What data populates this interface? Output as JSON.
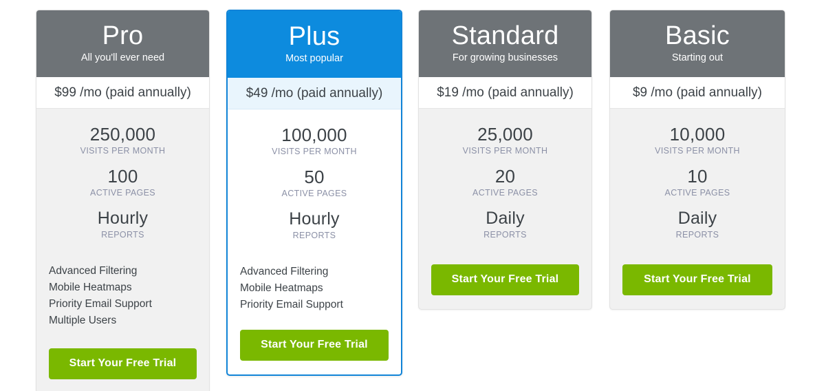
{
  "theme": {
    "header_gray": "#6e7377",
    "header_blue": "#0d8bde",
    "cta_green": "#7ab800",
    "stat_label_color": "#8b90a6",
    "body_gray": "#f1f1f1",
    "featured_price_bg": "#e9f5fd",
    "featured_border": "#1184d8"
  },
  "plans": [
    {
      "id": "pro",
      "name": "Pro",
      "tagline": "All you'll ever need",
      "price": "$99",
      "price_suffix": " /mo (paid annually)",
      "featured": false,
      "stats": [
        {
          "value": "250,000",
          "label": "VISITS PER MONTH"
        },
        {
          "value": "100",
          "label": "ACTIVE PAGES"
        },
        {
          "value": "Hourly",
          "label": "REPORTS"
        }
      ],
      "features": [
        "Advanced Filtering",
        "Mobile Heatmaps",
        "Priority Email Support",
        "Multiple Users"
      ],
      "cta_label": "Start Your Free Trial"
    },
    {
      "id": "plus",
      "name": "Plus",
      "tagline": "Most popular",
      "price": "$49",
      "price_suffix": " /mo (paid annually)",
      "featured": true,
      "stats": [
        {
          "value": "100,000",
          "label": "VISITS PER MONTH"
        },
        {
          "value": "50",
          "label": "ACTIVE PAGES"
        },
        {
          "value": "Hourly",
          "label": "REPORTS"
        }
      ],
      "features": [
        "Advanced Filtering",
        "Mobile Heatmaps",
        "Priority Email Support"
      ],
      "cta_label": "Start Your Free Trial"
    },
    {
      "id": "standard",
      "name": "Standard",
      "tagline": "For growing businesses",
      "price": "$19",
      "price_suffix": " /mo (paid annually)",
      "featured": false,
      "stats": [
        {
          "value": "25,000",
          "label": "VISITS PER MONTH"
        },
        {
          "value": "20",
          "label": "ACTIVE PAGES"
        },
        {
          "value": "Daily",
          "label": "REPORTS"
        }
      ],
      "features": [],
      "cta_label": "Start Your Free Trial"
    },
    {
      "id": "basic",
      "name": "Basic",
      "tagline": "Starting out",
      "price": "$9",
      "price_suffix": " /mo (paid annually)",
      "featured": false,
      "stats": [
        {
          "value": "10,000",
          "label": "VISITS PER MONTH"
        },
        {
          "value": "10",
          "label": "ACTIVE PAGES"
        },
        {
          "value": "Daily",
          "label": "REPORTS"
        }
      ],
      "features": [],
      "cta_label": "Start Your Free Trial"
    }
  ]
}
